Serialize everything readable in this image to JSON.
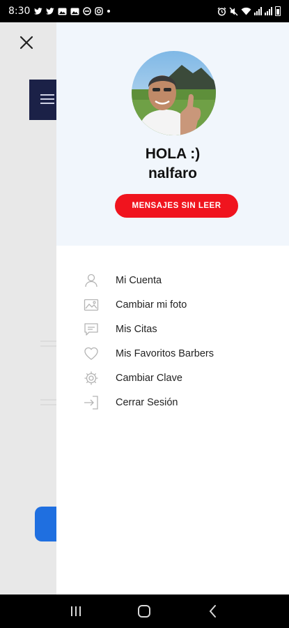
{
  "status_bar": {
    "time": "8:30",
    "left_icons": [
      "twitter-icon",
      "twitter-icon",
      "gallery-icon",
      "gallery-icon",
      "no-disturb-icon",
      "instagram-icon",
      "dot-icon"
    ],
    "right_icons": [
      "alarm-icon",
      "mute-icon",
      "wifi-icon",
      "signal-icon",
      "signal-icon",
      "battery-icon"
    ]
  },
  "drawer": {
    "greeting": "HOLA :)",
    "username": "nalfaro",
    "unread_button": "MENSAJES SIN LEER",
    "menu": [
      {
        "label": "Mi Cuenta",
        "icon": "user-icon"
      },
      {
        "label": "Cambiar mi foto",
        "icon": "image-icon"
      },
      {
        "label": "Mis Citas",
        "icon": "chat-icon"
      },
      {
        "label": "Mis Favoritos Barbers",
        "icon": "heart-icon"
      },
      {
        "label": "Cambiar Clave",
        "icon": "gear-icon"
      },
      {
        "label": "Cerrar Sesión",
        "icon": "logout-icon"
      }
    ]
  },
  "colors": {
    "accent_red": "#f0141e",
    "header_bg": "#f1f6fc",
    "bg_menu_navy": "#1b2147",
    "bg_button_blue": "#1f6fe0"
  },
  "nav_bar": {
    "buttons": [
      "recent-apps-icon",
      "home-icon",
      "back-icon"
    ]
  }
}
